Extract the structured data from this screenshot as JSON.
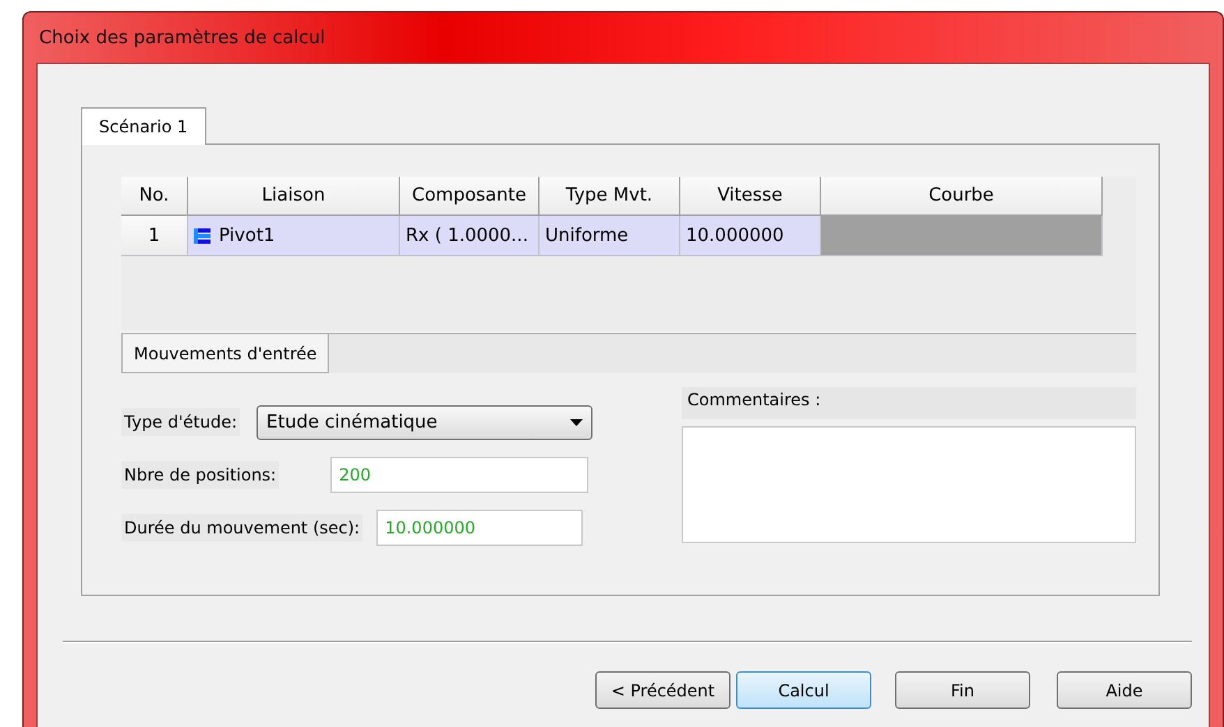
{
  "window": {
    "title": "Choix des paramètres de calcul"
  },
  "tabs": [
    {
      "label": "Scénario 1",
      "selected": true
    }
  ],
  "table": {
    "columns": [
      "No.",
      "Liaison",
      "Composante",
      "Type Mvt.",
      "Vitesse",
      "Courbe"
    ],
    "rows": [
      {
        "no": "1",
        "liaison": "Pivot1",
        "composante": "Rx ( 1.0000...",
        "type_mvt": "Uniforme",
        "vitesse": "10.000000",
        "selected": true
      }
    ]
  },
  "subtabs": [
    {
      "label": "Mouvements d'entrée",
      "selected": true
    }
  ],
  "form": {
    "type_etude": {
      "label": "Type d'étude:",
      "value": "Etude cinématique"
    },
    "nbre_positions": {
      "label": "Nbre de positions:",
      "value": "200"
    },
    "duree": {
      "label": "Durée du mouvement (sec):",
      "value": "10.000000"
    },
    "commentaires": {
      "label": "Commentaires :"
    }
  },
  "buttons": [
    {
      "label": "< Précédent",
      "focused": false
    },
    {
      "label": "Calcul",
      "focused": true
    },
    {
      "label": "Fin",
      "focused": false
    },
    {
      "label": "Aide",
      "focused": false
    }
  ]
}
